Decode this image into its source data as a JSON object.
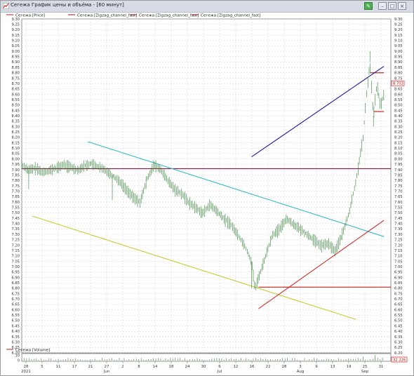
{
  "window": {
    "title": "Сегежа График цены и объёма - [60 минут]",
    "buttons": {
      "minimize": "–",
      "maximize": "□",
      "close": "×"
    }
  },
  "legend": [
    {
      "label": "Сегежа [Price]",
      "color": "#b22222"
    },
    {
      "label": "Сегежа [Zigzag_channel_fast]",
      "color": "#8b1a1a"
    },
    {
      "label": "Сегежа [Zigzag_channel_fast]",
      "color": "#8b1a1a"
    },
    {
      "label": "Сегежа [Zigzag_channel_fast]",
      "color": "#8b1a1a"
    }
  ],
  "volume_legend": {
    "label": "Сегежа [Volume]",
    "color": "#b22222"
  },
  "price_badge": {
    "value": "8.703",
    "color": "#cc0000"
  },
  "volume_badge": {
    "value": "32 226",
    "color": "#cc0000"
  },
  "volume_axis": {
    "ticks": [
      "10",
      "0"
    ]
  },
  "colors": {
    "candle_up": "#2e7d32",
    "candle_down": "#2e7d32",
    "grid": "#c8c8c8",
    "horizontal_level": "#8b1a4a",
    "support_level": "#cc2222",
    "cyan_line": "#33b8cc",
    "yellow_line": "#c8c830",
    "blue_line": "#1a1aa0",
    "red_line": "#d43030"
  },
  "x_axis": {
    "ticks": [
      "28",
      "5",
      "11",
      "17",
      "21",
      "27",
      "2",
      "8",
      "14",
      "18",
      "24",
      "30",
      "6",
      "12",
      "16",
      "22",
      "28",
      "3",
      "9",
      "13",
      "19",
      "25",
      "31"
    ],
    "months": [
      "2021",
      "Jun",
      "Jul",
      "Aug",
      "Sep"
    ]
  },
  "chart_data": {
    "type": "line",
    "title": "Сегежа График цены и объёма - [60 минут]",
    "series_name": "Сегежа [Price]",
    "ylim": [
      6.2,
      9.3
    ],
    "yticks": [
      6.2,
      6.25,
      6.3,
      6.35,
      6.4,
      6.45,
      6.5,
      6.55,
      6.6,
      6.65,
      6.7,
      6.75,
      6.8,
      6.85,
      6.9,
      6.95,
      7.0,
      7.05,
      7.1,
      7.15,
      7.2,
      7.25,
      7.3,
      7.35,
      7.4,
      7.45,
      7.5,
      7.55,
      7.6,
      7.65,
      7.7,
      7.75,
      7.8,
      7.85,
      7.9,
      7.95,
      8.0,
      8.05,
      8.1,
      8.15,
      8.2,
      8.25,
      8.3,
      8.35,
      8.4,
      8.45,
      8.5,
      8.55,
      8.6,
      8.65,
      8.7,
      8.75,
      8.8,
      8.85,
      8.9,
      8.95,
      9.0,
      9.05,
      9.1,
      9.15,
      9.2,
      9.25,
      9.3
    ],
    "price_path": [
      [
        0,
        7.95
      ],
      [
        2,
        7.9
      ],
      [
        4,
        7.92
      ],
      [
        6,
        7.88
      ],
      [
        8,
        7.9
      ],
      [
        10,
        7.92
      ],
      [
        12,
        7.95
      ],
      [
        14,
        7.93
      ],
      [
        16,
        7.9
      ],
      [
        18,
        7.94
      ],
      [
        20,
        7.96
      ],
      [
        22,
        7.93
      ],
      [
        24,
        7.9
      ],
      [
        26,
        7.85
      ],
      [
        28,
        7.8
      ],
      [
        30,
        7.72
      ],
      [
        32,
        7.65
      ],
      [
        34,
        7.6
      ],
      [
        36,
        7.82
      ],
      [
        38,
        7.95
      ],
      [
        40,
        7.9
      ],
      [
        42,
        7.8
      ],
      [
        44,
        7.72
      ],
      [
        46,
        7.68
      ],
      [
        48,
        7.6
      ],
      [
        50,
        7.55
      ],
      [
        52,
        7.5
      ],
      [
        54,
        7.58
      ],
      [
        56,
        7.52
      ],
      [
        58,
        7.45
      ],
      [
        60,
        7.4
      ],
      [
        62,
        7.3
      ],
      [
        64,
        7.2
      ],
      [
        66,
        7.05
      ],
      [
        67,
        6.8
      ],
      [
        68,
        6.9
      ],
      [
        70,
        7.1
      ],
      [
        72,
        7.3
      ],
      [
        74,
        7.35
      ],
      [
        76,
        7.45
      ],
      [
        78,
        7.4
      ],
      [
        80,
        7.35
      ],
      [
        82,
        7.3
      ],
      [
        84,
        7.25
      ],
      [
        86,
        7.2
      ],
      [
        88,
        7.22
      ],
      [
        90,
        7.15
      ],
      [
        92,
        7.3
      ],
      [
        94,
        7.5
      ],
      [
        96,
        7.8
      ],
      [
        98,
        8.2
      ],
      [
        99,
        8.6
      ],
      [
        100,
        8.9
      ],
      [
        101,
        8.4
      ],
      [
        102,
        8.7
      ],
      [
        103,
        8.5
      ],
      [
        104,
        8.6
      ]
    ],
    "levels": [
      {
        "name": "resistance",
        "y": 7.91
      },
      {
        "name": "support",
        "y": 6.81
      },
      {
        "name": "top",
        "y": 8.8
      },
      {
        "name": "mid",
        "y": 8.44
      }
    ],
    "trendlines": [
      {
        "name": "cyan",
        "from": [
          19,
          8.16
        ],
        "to": [
          104,
          7.28
        ]
      },
      {
        "name": "yellow",
        "from": [
          3,
          7.47
        ],
        "to": [
          96,
          6.51
        ]
      },
      {
        "name": "blue",
        "from": [
          66,
          8.02
        ],
        "to": [
          104,
          8.86
        ]
      },
      {
        "name": "red",
        "from": [
          68,
          6.61
        ],
        "to": [
          104,
          7.43
        ]
      }
    ],
    "xlim": [
      0,
      106
    ]
  }
}
